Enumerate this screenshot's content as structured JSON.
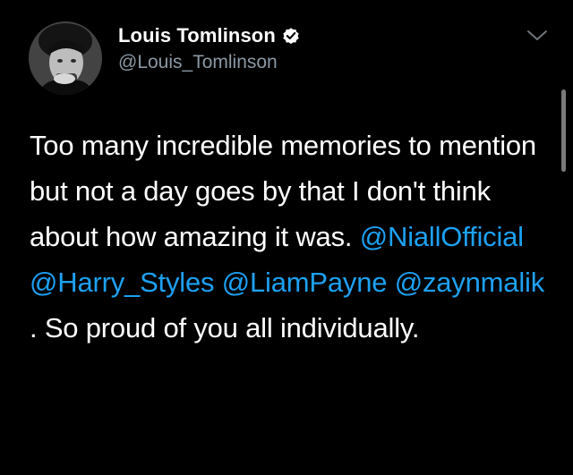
{
  "author": {
    "display_name": "Louis Tomlinson",
    "handle": "@Louis_Tomlinson",
    "verified": true,
    "avatar_icon": "profile-photo"
  },
  "menu_icon": "chevron-down-icon",
  "tweet": {
    "segment_1": "Too many incredible memories to mention but not a day goes by that I don't think about how amazing it was. ",
    "mention_1": "@NiallOfficial",
    "mention_2": "@Harry_Styles",
    "mention_3": "@LiamPayne",
    "mention_4": "@zaynmalik",
    "segment_2": " . So proud of you all individually."
  },
  "colors": {
    "background": "#000000",
    "text": "#ffffff",
    "secondary_text": "#8b98a5",
    "link": "#1da1f2"
  }
}
